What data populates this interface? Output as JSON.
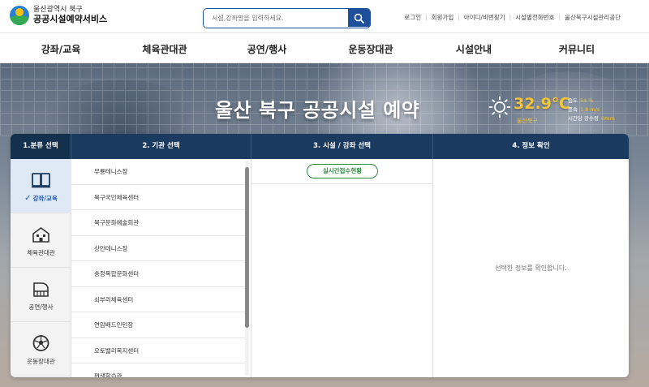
{
  "header": {
    "logo_sub": "울산광역시 북구",
    "logo_main": "공공시설예약서비스",
    "search_placeholder": "시설,강좌명을 입력하세요.",
    "top_links": [
      "로그인",
      "회원가입",
      "아이디/비번찾기",
      "시설별전화번호",
      "울산북구시설관리공단"
    ]
  },
  "nav": {
    "items": [
      "강좌/교육",
      "체육관대관",
      "공연/행사",
      "운동장대관",
      "시설안내",
      "커뮤니티"
    ]
  },
  "hero": {
    "title": "울산 북구 공공시설 예약"
  },
  "weather": {
    "temperature": "32.9℃",
    "region": "울산북구",
    "humidity_label": "습도",
    "humidity_value": "54 %",
    "wind_label": "풍속",
    "wind_value": "1.8 m/s",
    "rain_label": "시간당 강수량",
    "rain_value": "0mm",
    "icon": "sun-icon",
    "accent_color": "#f5c53a"
  },
  "panel": {
    "headers": [
      "1.분류 선택",
      "2. 기관 선택",
      "3. 시설 / 강좌 선택",
      "4. 정보 확인"
    ],
    "categories": [
      {
        "label": "강좌/교육",
        "icon": "book-icon",
        "active": true,
        "check": "✓"
      },
      {
        "label": "체육관대관",
        "icon": "building-icon",
        "active": false
      },
      {
        "label": "공연/행사",
        "icon": "piano-icon",
        "active": false
      },
      {
        "label": "운동장대관",
        "icon": "soccer-ball-icon",
        "active": false
      }
    ],
    "institutions": [
      "무룡테니스장",
      "북구국민체육센터",
      "북구문화예술회관",
      "상안테니스장",
      "송정복합문화센터",
      "쇠부리체육센터",
      "연암배드민턴장",
      "오토밸리복지센터",
      "편생학습관"
    ],
    "realtime_button": "실시간접수현황",
    "info_placeholder": "선택한 정보를 확인합니다.",
    "colors": {
      "header_bg": "#1a3a60",
      "active_blue": "#1a56b0",
      "green": "#2e8b45"
    }
  }
}
